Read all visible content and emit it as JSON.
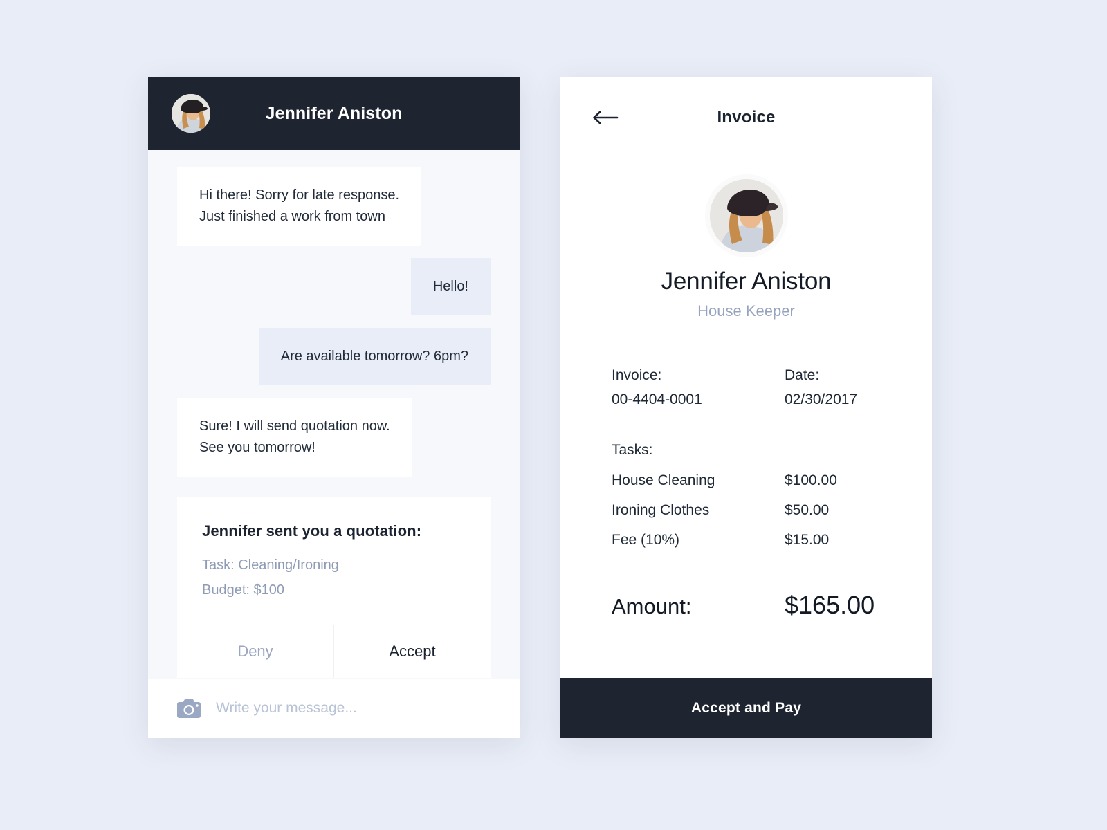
{
  "theme": {
    "page_bg": "#e9edf7",
    "dark": "#1e2430",
    "chat_bg": "#f6f8fb",
    "bubble_in": "#ffffff",
    "bubble_out": "#e8edf7",
    "muted": "#97a3bd",
    "text": "#1b2330"
  },
  "chat": {
    "header": {
      "contact_name": "Jennifer Aniston",
      "avatar_icon": "avatar-photo"
    },
    "messages": [
      {
        "direction": "in",
        "text": "Hi there! Sorry for late response.\nJust finished a work from town"
      },
      {
        "direction": "out",
        "text": "Hello!"
      },
      {
        "direction": "out",
        "text": "Are available tomorrow? 6pm?"
      },
      {
        "direction": "in",
        "text": "Sure! I will send quotation now.\nSee you tomorrow!"
      }
    ],
    "quotation": {
      "title": "Jennifer sent you a quotation:",
      "task_line": "Task: Cleaning/Ironing",
      "budget_line": "Budget: $100",
      "deny_label": "Deny",
      "accept_label": "Accept"
    },
    "composer": {
      "camera_icon": "camera-icon",
      "placeholder": "Write your message...",
      "value": ""
    }
  },
  "invoice": {
    "back_icon": "arrow-left-icon",
    "title": "Invoice",
    "avatar_icon": "avatar-photo",
    "name": "Jennifer Aniston",
    "role": "House Keeper",
    "meta": {
      "invoice_label": "Invoice:",
      "invoice_number": "00-4404-0001",
      "date_label": "Date:",
      "date_value": "02/30/2017"
    },
    "tasks_label": "Tasks:",
    "tasks": [
      {
        "name": "House Cleaning",
        "price": "$100.00"
      },
      {
        "name": "Ironing Clothes",
        "price": "$50.00"
      },
      {
        "name": "Fee (10%)",
        "price": "$15.00"
      }
    ],
    "total": {
      "label": "Amount:",
      "value": "$165.00"
    },
    "pay_button_label": "Accept and Pay"
  }
}
